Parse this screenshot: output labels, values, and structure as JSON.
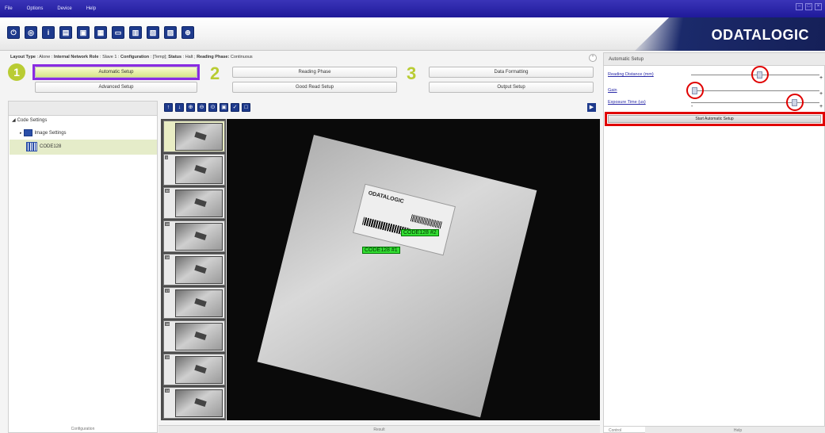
{
  "menu": [
    "File",
    "Options",
    "Device",
    "Help"
  ],
  "window_controls": [
    "–",
    "□",
    "×"
  ],
  "toolbar": {
    "icons": [
      "connect-icon",
      "disconnect-icon",
      "device-info-icon",
      "open-icon",
      "save-icon",
      "capture-icon",
      "monitor-icon",
      "statistics-icon",
      "terminal-icon",
      "diagnostics-icon",
      "network-icon"
    ],
    "logo": "ODATALOGIC"
  },
  "info": {
    "layout_label": "Layout Type",
    "layout_value": "Alone",
    "role_label": "Internal Network Role",
    "role_value": "Slave 1",
    "config_label": "Configuration",
    "config_value": "[Temp]",
    "status_label": "Status",
    "status_value": "Halt",
    "phase_label": "Reading Phase:",
    "phase_value": "Continuous"
  },
  "steps": {
    "num1": "1",
    "num2": "2",
    "num3": "3",
    "automatic_setup": "Automatic Setup",
    "advanced_setup": "Advanced Setup",
    "reading_phase": "Reading Phase",
    "good_read_setup": "Good Read Setup",
    "data_formatting": "Data Formatting",
    "output_setup": "Output Setup"
  },
  "tree": {
    "root": "Code Settings",
    "image_settings": "Image Settings",
    "code": "CODE128"
  },
  "footer": {
    "left": "Configuration",
    "center": "Result"
  },
  "thumbnails": [
    "",
    "1",
    "30",
    "19",
    "18",
    "17",
    "16",
    "15",
    "14"
  ],
  "image": {
    "label_logo": "ODATALOGIC",
    "tag_a": "CODE128 #1",
    "tag_b": "CODE128 #2"
  },
  "right_panel": {
    "title": "Automatic Setup",
    "params": [
      {
        "label": "Reading Distance (mm)",
        "value": 0.53
      },
      {
        "label": "Gain",
        "value": 0.02
      },
      {
        "label": "Exposure Time (us)",
        "value": 0.78
      }
    ],
    "start_button": "Start Automatic Setup",
    "tab_control": "Control",
    "tab_help": "Help"
  },
  "colors": {
    "menubar": "#2a24ae",
    "accent_green": "#b9cc33",
    "highlight_purple": "#8a2be2",
    "highlight_red": "#e00000",
    "code_tag": "#33dd33"
  }
}
